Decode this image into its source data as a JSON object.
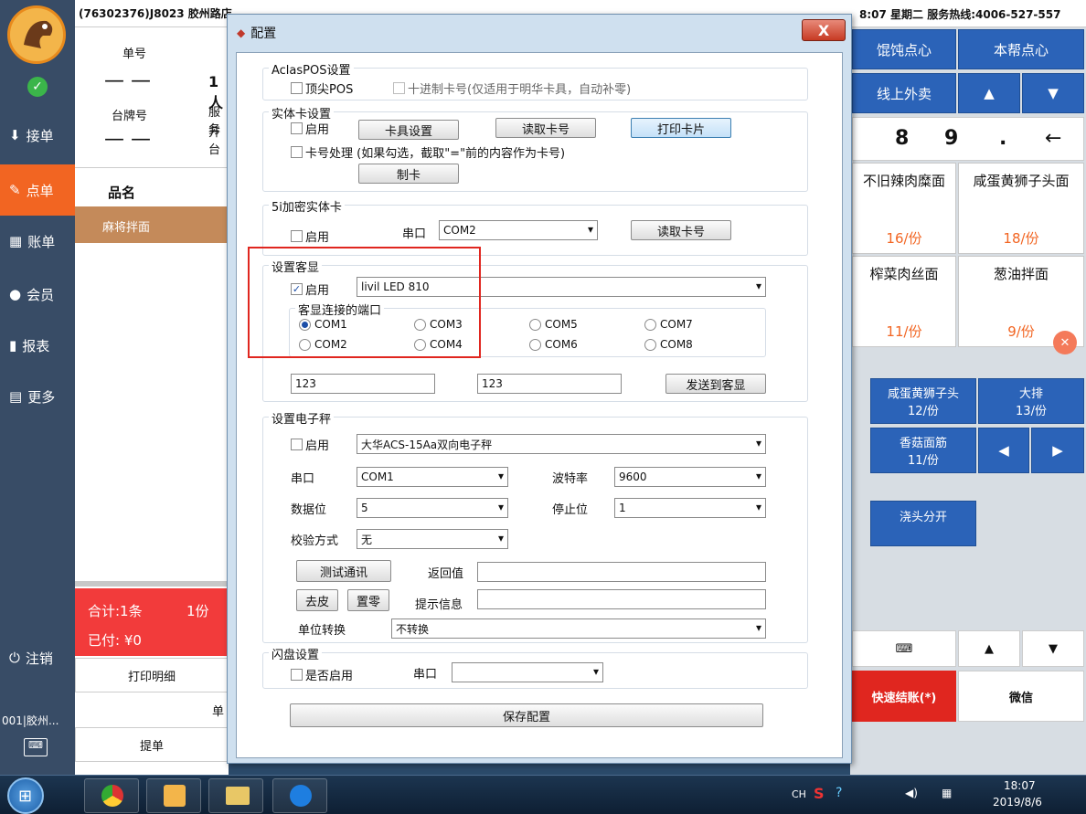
{
  "topbar": {
    "store": "(76302376)J8023 胶州路店",
    "time_text": "8:07  星期二  服务热线:4006-527-557"
  },
  "sidebar": {
    "items": [
      {
        "label": "接单",
        "icon": "receive-icon"
      },
      {
        "label": "点单",
        "icon": "edit-icon"
      },
      {
        "label": "账单",
        "icon": "grid-icon"
      },
      {
        "label": "会员",
        "icon": "user-icon"
      },
      {
        "label": "报表",
        "icon": "chart-icon"
      },
      {
        "label": "更多",
        "icon": "more-icon"
      }
    ],
    "logout": "注销",
    "store_short": "001|胶州..."
  },
  "order": {
    "bill_no_label": "单号",
    "bill_no_value": "— —",
    "table_label": "台牌号",
    "table_value": "— —",
    "people": "1人",
    "waiter": "服务",
    "opened": "开台",
    "col_header": "品名",
    "items": [
      "麻将拌面"
    ],
    "total": "合计:1条",
    "total_qty": "1份",
    "paid": "已付: ¥0",
    "print_detail": "打印明细",
    "single": "单",
    "take_order": "提单"
  },
  "right": {
    "cat1": "馄饨点心",
    "cat2": "本帮点心",
    "cat3": "线上外卖",
    "keys": [
      "8",
      "9",
      ".",
      "←"
    ],
    "dishes": [
      {
        "name": "不旧辣肉糜面",
        "price": "16/份"
      },
      {
        "name": "咸蛋黄狮子头面",
        "price": "18/份"
      },
      {
        "name": "榨菜肉丝面",
        "price": "11/份"
      },
      {
        "name": "葱油拌面",
        "price": "9/份"
      }
    ],
    "blue_dishes": [
      {
        "name": "咸蛋黄狮子头",
        "price": "12/份"
      },
      {
        "name": "大排",
        "price": "13/份"
      },
      {
        "name": "香菇面筋",
        "price": "11/份"
      },
      {
        "name": "浇头分开",
        "price": ""
      }
    ],
    "quick_pay": "快速结账(*)",
    "wechat": "微信"
  },
  "dialog": {
    "title": "配置",
    "close": "X",
    "aclas": {
      "title": "AclasPOS设置",
      "dingjian": "顶尖POS",
      "decimal": "十进制卡号(仅适用于明华卡具，自动补零)"
    },
    "card": {
      "title": "实体卡设置",
      "enable": "启用",
      "card_setting": "卡具设置",
      "read_card": "读取卡号",
      "print_card": "打印卡片",
      "card_process": "卡号处理  (如果勾选，截取\"=\"前的内容作为卡号)",
      "make_card": "制卡"
    },
    "card5i": {
      "title": "5i加密实体卡",
      "enable": "启用",
      "port_label": "串口",
      "port_value": "COM2",
      "read_card": "读取卡号"
    },
    "display": {
      "title": "设置客显",
      "enable": "启用",
      "device": "livil LED 810",
      "port_group": "客显连接的端口",
      "ports": [
        "COM1",
        "COM3",
        "COM5",
        "COM7",
        "COM2",
        "COM4",
        "COM6",
        "COM8"
      ],
      "selected_port": "COM1",
      "text1": "123",
      "text2": "123",
      "send": "发送到客显"
    },
    "scale": {
      "title": "设置电子秤",
      "enable": "启用",
      "device": "大华ACS-15Aa双向电子秤",
      "port_label": "串口",
      "port_value": "COM1",
      "baud_label": "波特率",
      "baud_value": "9600",
      "databits_label": "数据位",
      "databits_value": "5",
      "stopbits_label": "停止位",
      "stopbits_value": "1",
      "parity_label": "校验方式",
      "parity_value": "无",
      "test": "测试通讯",
      "return_label": "返回值",
      "tare": "去皮",
      "zero": "置零",
      "info_label": "提示信息",
      "unit_label": "单位转换",
      "unit_value": "不转换"
    },
    "flash": {
      "title": "闪盘设置",
      "enable": "是否启用",
      "port_label": "串口",
      "port_value": ""
    },
    "save": "保存配置"
  },
  "taskbar": {
    "lang": "CH",
    "time": "18:07",
    "date": "2019/8/6"
  },
  "colors": {
    "accent": "#f26522",
    "sidebar": "#384c66",
    "blue_btn": "#2b63b8",
    "highlight": "#e0261f"
  }
}
